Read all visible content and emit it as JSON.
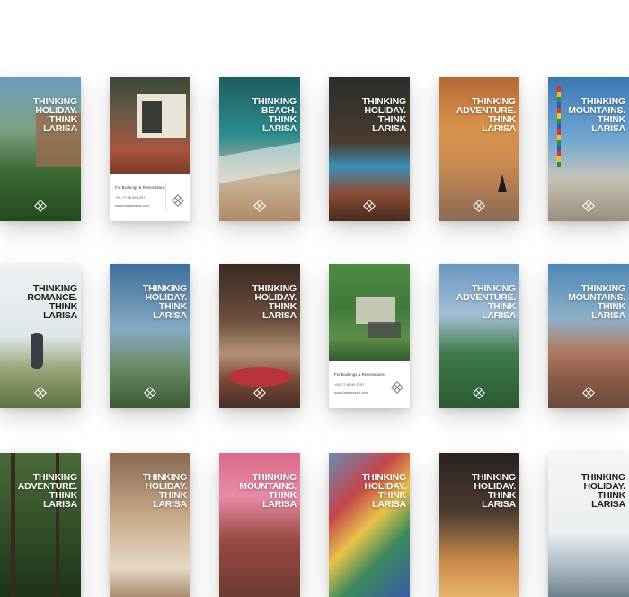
{
  "brand": {
    "accent": "#ffffff",
    "logo_icon": "larisa-lattice-logo-icon"
  },
  "booking_card": {
    "title": "For Bookings & Reservations",
    "phone": "+91 77 88 99 1297",
    "website": "www.larisaresort.com"
  },
  "cards": [
    {
      "headline": "Thinking\nHoliday.\nThink\nLarisa",
      "theme": "resort-garden"
    },
    {
      "headline": "",
      "theme": "villa-booking"
    },
    {
      "headline": "Thinking\nBeach.\nThink\nLarisa",
      "theme": "aerial-beach"
    },
    {
      "headline": "Thinking\nHoliday.\nThink\nLarisa",
      "theme": "pool-night"
    },
    {
      "headline": "Thinking\nAdventure.\nThink\nLarisa",
      "theme": "sunset-sea"
    },
    {
      "headline": "Thinking\nMountains.\nThink\nLarisa",
      "theme": "prayer-flags"
    },
    {
      "headline": "Thinking\nRomance.\nThink\nLarisa",
      "theme": "couple-meadow"
    },
    {
      "headline": "Thinking\nHoliday.\nThink\nLarisa",
      "theme": "hill-valley"
    },
    {
      "headline": "Thinking\nHoliday.\nThink\nLarisa",
      "theme": "spa-room"
    },
    {
      "headline": "",
      "theme": "aerial-resort-booking"
    },
    {
      "headline": "Thinking\nAdventure.\nThink\nLarisa",
      "theme": "green-hills"
    },
    {
      "headline": "Thinking\nMountains.\nThink\nLarisa",
      "theme": "hill-town"
    },
    {
      "headline": "Thinking\nAdventure.\nThink\nLarisa",
      "theme": "forest"
    },
    {
      "headline": "Thinking\nHoliday.\nThink\nLarisa",
      "theme": "bedroom"
    },
    {
      "headline": "Thinking\nMountains.\nThink\nLarisa",
      "theme": "pink-sky-town"
    },
    {
      "headline": "Thinking\nHoliday.\nThink\nLarisa",
      "theme": "colorful-flags"
    },
    {
      "headline": "Thinking\nHoliday.\nThink\nLarisa",
      "theme": "night-terrace"
    },
    {
      "headline": "Thinking\nHoliday.\nThink\nLarisa",
      "theme": "white-mountains"
    }
  ]
}
